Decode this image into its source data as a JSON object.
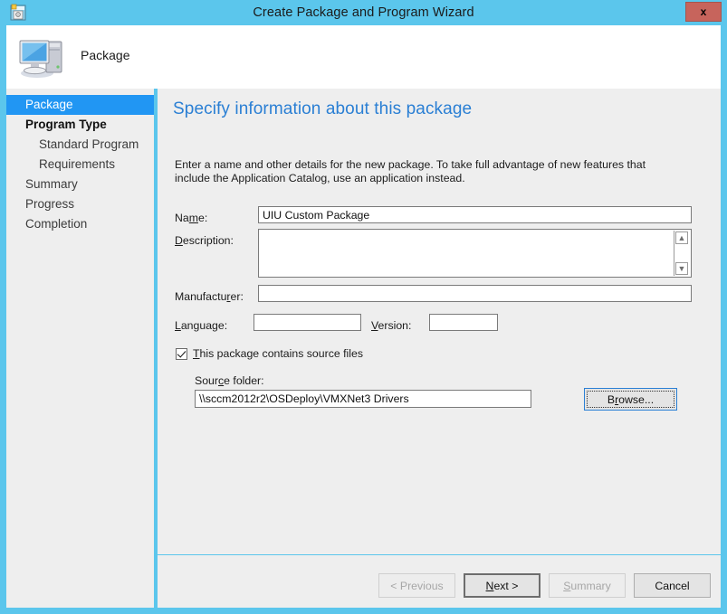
{
  "window": {
    "title": "Create Package and Program Wizard",
    "close_label": "x",
    "icon": "package-wizard-icon",
    "frame_color": "#5bc6ec"
  },
  "banner": {
    "label": "Package",
    "icon": "computer-icon"
  },
  "sidebar": {
    "items": [
      {
        "label": "Package",
        "state": "selected",
        "level": 0
      },
      {
        "label": "Program Type",
        "state": "strong",
        "level": 0
      },
      {
        "label": "Standard Program",
        "state": "normal",
        "level": 1
      },
      {
        "label": "Requirements",
        "state": "normal",
        "level": 1
      },
      {
        "label": "Summary",
        "state": "normal",
        "level": 0
      },
      {
        "label": "Progress",
        "state": "normal",
        "level": 0
      },
      {
        "label": "Completion",
        "state": "normal",
        "level": 0
      }
    ],
    "selected_color": "#2196f3"
  },
  "content": {
    "heading": "Specify information about this package",
    "heading_color": "#2a7fd4",
    "description": "Enter a name and other details for the new package. To take full advantage of new features that include the Application Catalog, use an application instead.",
    "fields": {
      "name": {
        "label_pre": "Na",
        "label_key": "m",
        "label_post": "e:",
        "value": "UIU Custom Package",
        "placeholder": ""
      },
      "description": {
        "label_pre": "",
        "label_key": "D",
        "label_post": "escription:",
        "value": "",
        "placeholder": ""
      },
      "manufacturer": {
        "label_pre": "Manufactu",
        "label_key": "r",
        "label_post": "er:",
        "value": "",
        "placeholder": ""
      },
      "language": {
        "label_pre": "",
        "label_key": "L",
        "label_post": "anguage:",
        "value": "",
        "placeholder": ""
      },
      "version": {
        "label_pre": "",
        "label_key": "V",
        "label_post": "ersion:",
        "value": "",
        "placeholder": ""
      }
    },
    "source_checkbox": {
      "label_pre": "",
      "label_key": "T",
      "label_post": "his package contains source files",
      "checked": true
    },
    "source_folder": {
      "label_pre": "Sour",
      "label_key": "c",
      "label_post": "e folder:",
      "value": "\\\\sccm2012r2\\OSDeploy\\VMXNet3 Drivers",
      "placeholder": ""
    },
    "browse_button": {
      "label_pre": "B",
      "label_key": "r",
      "label_post": "owse...",
      "focused": true
    },
    "scrollbar": {
      "up_icon": "chevron-up-icon",
      "down_icon": "chevron-down-icon"
    }
  },
  "footer": {
    "previous": {
      "label": "< Previous",
      "enabled": false
    },
    "next": {
      "label_pre": "",
      "label_key": "N",
      "label_post": "ext >",
      "enabled": true,
      "default": true
    },
    "summary": {
      "label_pre": "",
      "label_key": "S",
      "label_post": "ummary",
      "enabled": false
    },
    "cancel": {
      "label": "Cancel",
      "enabled": true
    }
  }
}
